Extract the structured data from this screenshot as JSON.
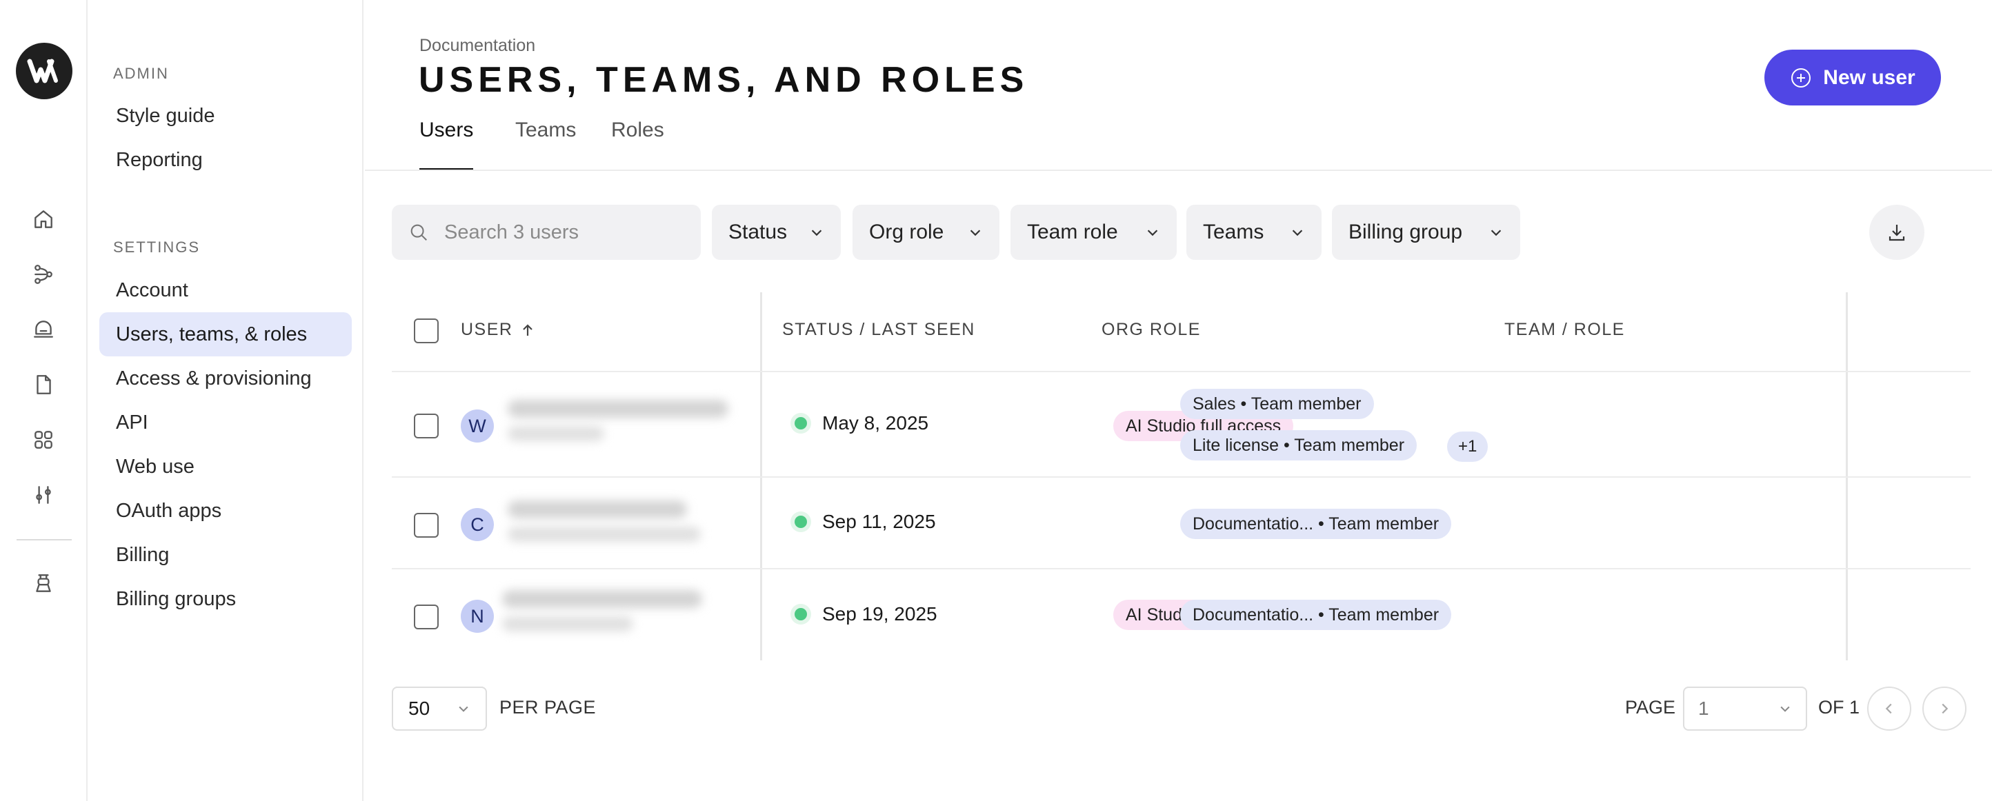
{
  "rail": {
    "icons": [
      "home-icon",
      "workflow-icon",
      "assistant-icon",
      "document-icon",
      "apps-icon",
      "sliders-icon",
      "agent-icon"
    ]
  },
  "sidebar": {
    "admin_label": "ADMIN",
    "admin_items": [
      {
        "label": "Style guide"
      },
      {
        "label": "Reporting"
      }
    ],
    "settings_label": "SETTINGS",
    "settings_items": [
      {
        "label": "Account"
      },
      {
        "label": "Users, teams, & roles",
        "active": true
      },
      {
        "label": "Access & provisioning"
      },
      {
        "label": "API"
      },
      {
        "label": "Web use"
      },
      {
        "label": "OAuth apps"
      },
      {
        "label": "Billing"
      },
      {
        "label": "Billing groups"
      }
    ]
  },
  "header": {
    "breadcrumb": "Documentation",
    "title": "USERS, TEAMS, AND ROLES",
    "new_user_label": "New user"
  },
  "tabs": [
    {
      "label": "Users",
      "active": true
    },
    {
      "label": "Teams"
    },
    {
      "label": "Roles"
    }
  ],
  "filters": {
    "search_placeholder": "Search 3 users",
    "items": [
      {
        "label": "Status"
      },
      {
        "label": "Org role"
      },
      {
        "label": "Team role"
      },
      {
        "label": "Teams"
      },
      {
        "label": "Billing group"
      }
    ]
  },
  "table": {
    "columns": {
      "user": "USER",
      "status": "STATUS / LAST SEEN",
      "org_role": "ORG ROLE",
      "team_role": "TEAM / ROLE"
    },
    "rows": [
      {
        "initial": "W",
        "last_seen": "May 8, 2025",
        "org_role": "AI Studio full access",
        "teams": [
          "Sales • Team member",
          "Lite license • Team member"
        ],
        "more": "+1"
      },
      {
        "initial": "C",
        "last_seen": "Sep 11, 2025",
        "org_role": "",
        "teams": [
          "Documentatio... • Team member"
        ]
      },
      {
        "initial": "N",
        "last_seen": "Sep 19, 2025",
        "org_role": "AI Studio builder",
        "teams": [
          "Documentatio... • Team member"
        ]
      }
    ]
  },
  "pagination": {
    "per_page_value": "50",
    "per_page_label": "PER PAGE",
    "page_label": "PAGE",
    "page_value": "1",
    "of_label": "OF 1"
  },
  "colors": {
    "accent": "#5046e5",
    "active_nav": "#e4e8fb",
    "status_online": "#4cc983",
    "org_role_pill": "#fbe1f3",
    "team_pill": "#e2e6f8"
  }
}
